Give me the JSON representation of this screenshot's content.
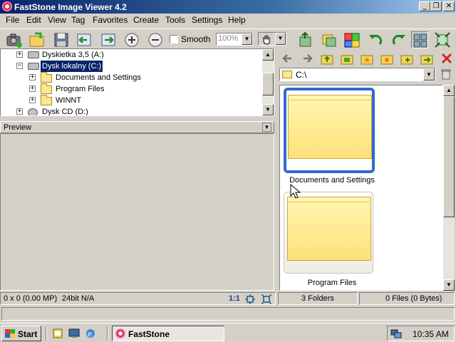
{
  "window": {
    "title": "FastStone Image Viewer 4.2",
    "minimize": "_",
    "maximize": "❐",
    "close": "✕"
  },
  "menu": [
    "File",
    "Edit",
    "View",
    "Tag",
    "Favorites",
    "Create",
    "Tools",
    "Settings",
    "Help"
  ],
  "toolbar": {
    "smooth_label": "Smooth",
    "zoom_value": "100%"
  },
  "tree": {
    "items": [
      {
        "label": "Dyskietka 3,5 (A:)",
        "expander": "+"
      },
      {
        "label": "Dysk lokalny (C:)",
        "expander": "−"
      },
      {
        "label": "Documents and Settings",
        "expander": "+"
      },
      {
        "label": "Program Files",
        "expander": "+"
      },
      {
        "label": "WINNT",
        "expander": "+"
      },
      {
        "label": "Dysk CD (D:)",
        "expander": "+"
      }
    ]
  },
  "preview": {
    "label": "Preview"
  },
  "path": {
    "value": "C:\\"
  },
  "thumbnails": [
    {
      "label": "Documents and Settings",
      "selected": true
    },
    {
      "label": "Program Files",
      "selected": false
    }
  ],
  "status": {
    "dimensions": "0 x 0 (0.00 MP)",
    "depth": "24bit N/A",
    "ratio": "1:1",
    "folders": "3 Folders",
    "files": "0 Files (0 Bytes)"
  },
  "taskbar": {
    "start": "Start",
    "task": "FastStone",
    "clock": "10:35 AM"
  },
  "colors": {
    "titlebar": "#0a246a",
    "selection": "#2f6ad0",
    "close_red": "#d22"
  }
}
